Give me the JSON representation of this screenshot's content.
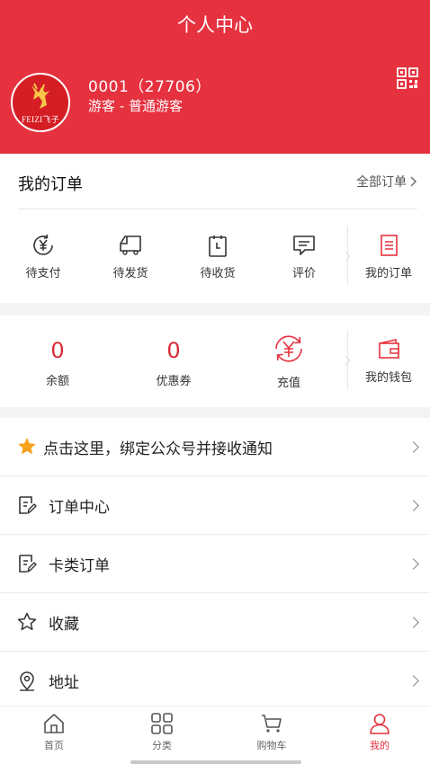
{
  "header": {
    "title": "个人中心",
    "user_id": "0001（27706）",
    "user_level": "游客 - 普通游客",
    "avatar_text": "FEIZI飞子"
  },
  "orders": {
    "title": "我的订单",
    "all_label": "全部订单",
    "items": [
      {
        "label": "待支付",
        "icon": "yen-payment-icon"
      },
      {
        "label": "待发货",
        "icon": "delivery-truck-icon"
      },
      {
        "label": "待收货",
        "icon": "clipboard-clock-icon"
      },
      {
        "label": "评价",
        "icon": "comment-icon"
      },
      {
        "label": "我的订单",
        "icon": "order-list-icon"
      }
    ]
  },
  "wallet": {
    "balance": {
      "value": "0",
      "label": "余额"
    },
    "coupon": {
      "value": "0",
      "label": "优惠券"
    },
    "recharge": {
      "label": "充值"
    },
    "my_wallet": {
      "label": "我的钱包"
    }
  },
  "menu": [
    {
      "label": "点击这里，绑定公众号并接收通知",
      "icon": "star-icon"
    },
    {
      "label": "订单中心",
      "icon": "document-edit-icon"
    },
    {
      "label": "卡类订单",
      "icon": "document-edit-icon"
    },
    {
      "label": "收藏",
      "icon": "star-outline-icon"
    },
    {
      "label": "地址",
      "icon": "location-pin-icon"
    }
  ],
  "tabbar": [
    {
      "label": "首页",
      "icon": "home-icon",
      "active": false
    },
    {
      "label": "分类",
      "icon": "grid-icon",
      "active": false
    },
    {
      "label": "购物车",
      "icon": "cart-icon",
      "active": false
    },
    {
      "label": "我的",
      "icon": "user-icon",
      "active": true
    }
  ],
  "colors": {
    "brand_red": "#e6313f",
    "value_red": "#d92b35"
  }
}
